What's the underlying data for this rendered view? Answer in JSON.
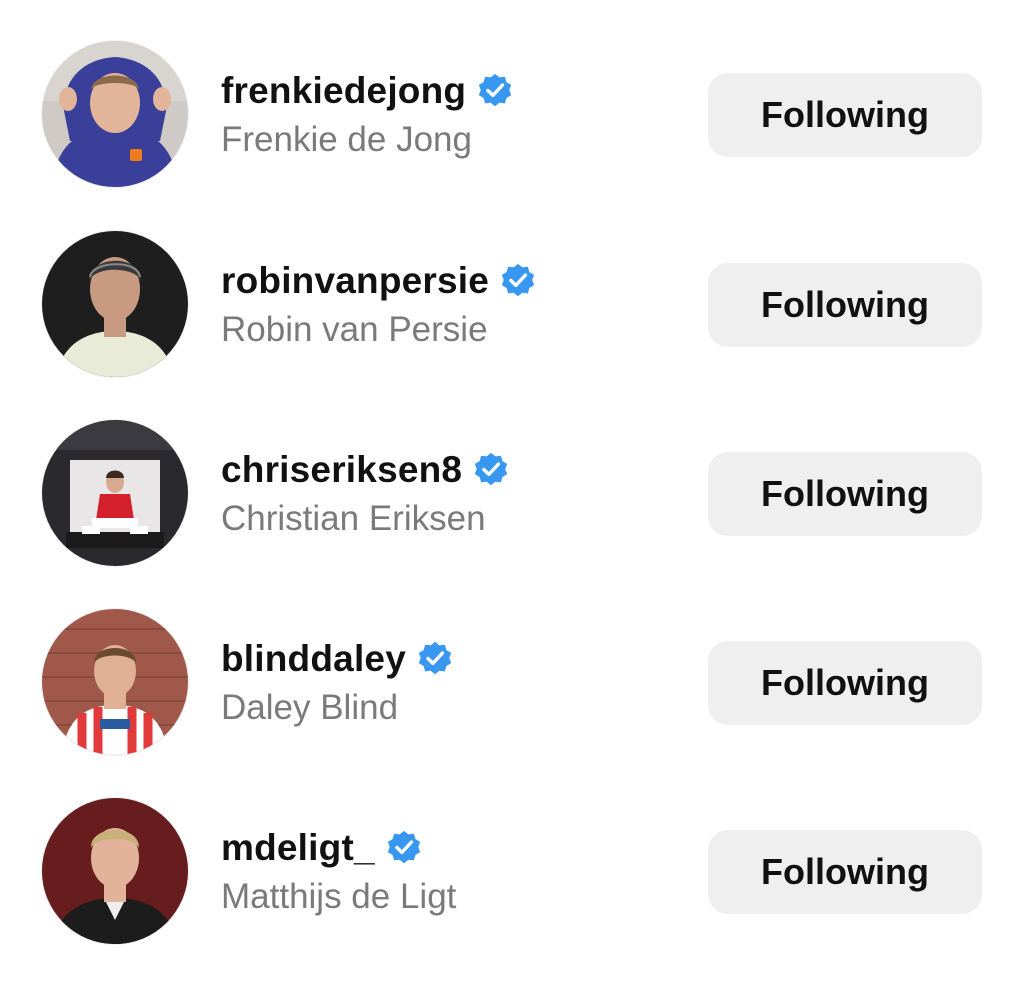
{
  "following_list": [
    {
      "username": "frenkiedejong",
      "full_name": "Frenkie de Jong",
      "verified": true,
      "button_label": "Following",
      "avatar_palette": {
        "bg": "#cfcac6",
        "shirt": "#3a3f9a",
        "skin": "#e2b49a",
        "hair": "#8a6a4a"
      }
    },
    {
      "username": "robinvanpersie",
      "full_name": "Robin van Persie",
      "verified": true,
      "button_label": "Following",
      "avatar_palette": {
        "bg": "#1e1e1e",
        "shirt": "#e7ebd8",
        "skin": "#c99a82",
        "hair": "#3a3a3a"
      }
    },
    {
      "username": "chriseriksen8",
      "full_name": "Christian Eriksen",
      "verified": true,
      "button_label": "Following",
      "avatar_palette": {
        "bg": "#2a2a2e",
        "shirt": "#d3202a",
        "skin": "#d7a98e",
        "hair": "#3b2a20"
      }
    },
    {
      "username": "blinddaley",
      "full_name": "Daley Blind",
      "verified": true,
      "button_label": "Following",
      "avatar_palette": {
        "bg": "#a0584a",
        "shirt": "#e23a3a",
        "skin": "#e0b094",
        "hair": "#6b4a30"
      }
    },
    {
      "username": "mdeligt_",
      "full_name": "Matthijs de Ligt",
      "verified": true,
      "button_label": "Following",
      "avatar_palette": {
        "bg": "#5a1a1a",
        "shirt": "#1c1c1c",
        "skin": "#e2b39a",
        "hair": "#c9b07a"
      }
    }
  ],
  "colors": {
    "badge": "#3897f0",
    "button_bg": "#efefef",
    "username": "#111111",
    "full_name": "#7a7a7a"
  },
  "icons": {
    "verified": "verified-badge-icon"
  }
}
